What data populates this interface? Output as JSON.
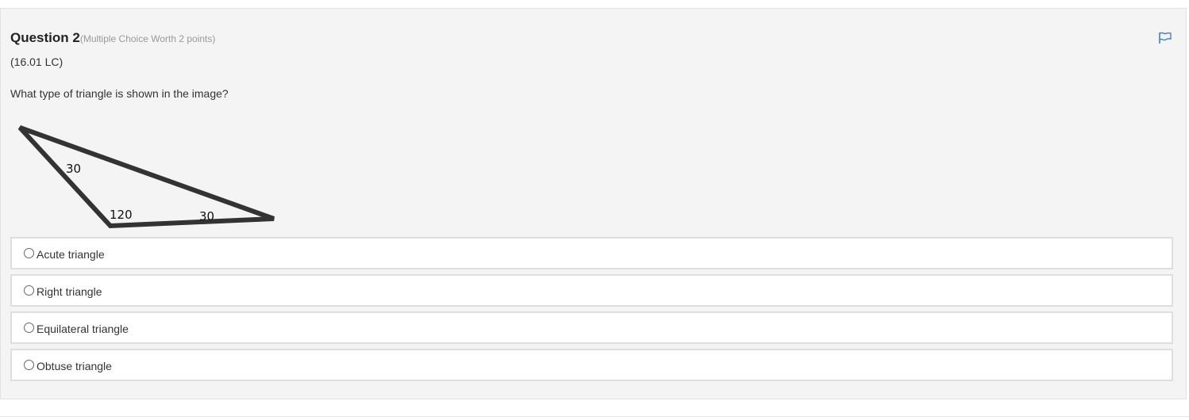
{
  "question": {
    "title": "Question 2",
    "meta": "(Multiple Choice Worth 2 points)",
    "code": "(16.01 LC)",
    "prompt": "What type of triangle is shown in the image?"
  },
  "figure": {
    "angle_top": "30",
    "angle_bottom_left": "120",
    "angle_bottom_right": "30"
  },
  "answers": [
    {
      "label": "Acute triangle",
      "selected": false
    },
    {
      "label": "Right triangle",
      "selected": false
    },
    {
      "label": "Equilateral triangle",
      "selected": false
    },
    {
      "label": "Obtuse triangle",
      "selected": false
    }
  ],
  "icons": {
    "flag": "flag-icon"
  },
  "colors": {
    "accent": "#4a7fc1",
    "panel_bg": "#f4f4f4",
    "answer_border": "#dedede"
  }
}
